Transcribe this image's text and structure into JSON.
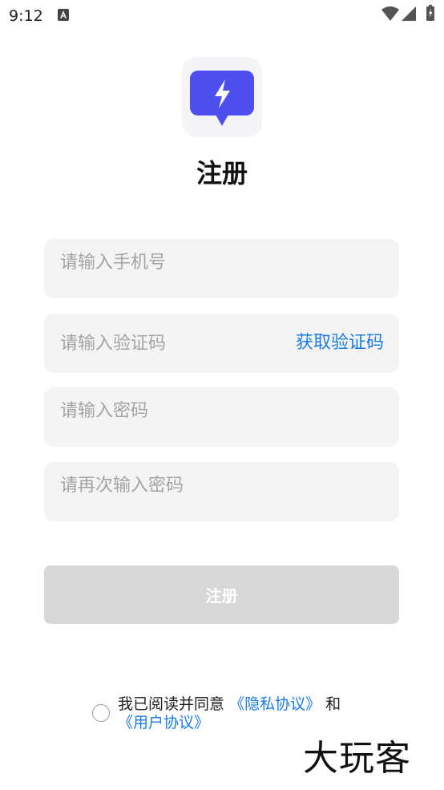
{
  "status_bar": {
    "time": "9:12",
    "icons": [
      "accessibility-a-icon",
      "wifi-icon",
      "cell-signal-icon",
      "battery-icon"
    ]
  },
  "logo": {
    "icon": "lightning-chat-bubble-icon",
    "brand_color": "#4f4ff0"
  },
  "page": {
    "title": "注册"
  },
  "form": {
    "phone_placeholder": "请输入手机号",
    "code_placeholder": "请输入验证码",
    "get_code_label": "获取验证码",
    "password_placeholder": "请输入密码",
    "password_confirm_placeholder": "请再次输入密码",
    "submit_label": "注册"
  },
  "agreement": {
    "prefix": "我已阅读并同意",
    "privacy_link": "《隐私协议》",
    "joiner": "和",
    "user_link": "《用户协议》"
  },
  "watermark": {
    "text": "大玩客"
  },
  "colors": {
    "link": "#1a7ce8",
    "field_bg": "#f4f4f4",
    "button_disabled": "#d8d8d8"
  }
}
